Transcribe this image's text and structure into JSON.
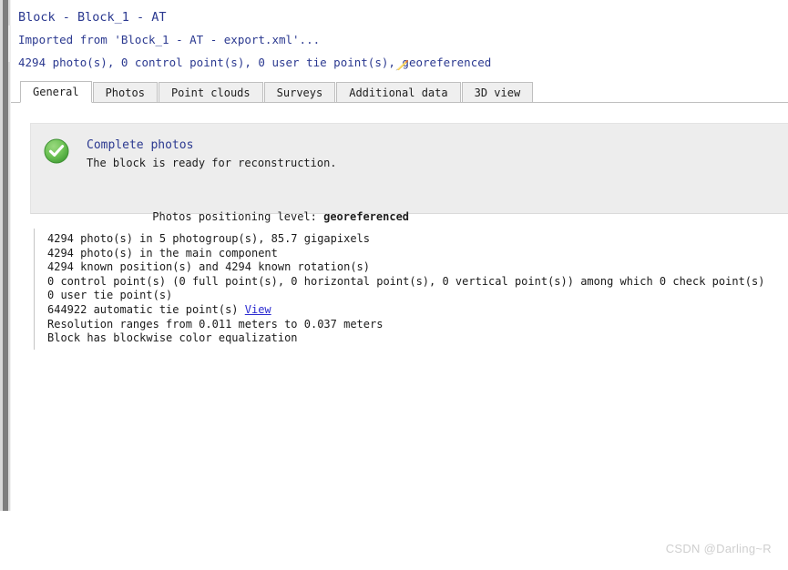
{
  "window": {
    "block_title": "Block - Block_1 - AT",
    "imported_line": "Imported from 'Block_1 - AT - export.xml'...",
    "summary_line": "4294 photo(s), 0 control point(s), 0 user tie point(s), georeferenced",
    "edit_icon": "pencil-icon",
    "title_color": "#2b3990"
  },
  "tabs": [
    {
      "label": "General",
      "active": true
    },
    {
      "label": "Photos",
      "active": false
    },
    {
      "label": "Point clouds",
      "active": false
    },
    {
      "label": "Surveys",
      "active": false
    },
    {
      "label": "Additional data",
      "active": false
    },
    {
      "label": "3D view",
      "active": false
    }
  ],
  "status_panel": {
    "icon": "success-check-icon",
    "icon_color": "#57b84b",
    "title": "Complete photos",
    "subtitle": "The block is ready for reconstruction.",
    "positioning_label": "Photos positioning level: ",
    "positioning_value": "georeferenced"
  },
  "statistics": {
    "lines": [
      "4294 photo(s) in 5 photogroup(s), 85.7 gigapixels",
      "4294 photo(s) in the main component",
      "4294 known position(s) and 4294 known rotation(s)",
      "0 control point(s) (0 full point(s), 0 horizontal point(s), 0 vertical point(s)) among which 0 check point(s)",
      "0 user tie point(s)"
    ],
    "tie_points_prefix": "644922 automatic tie point(s) ",
    "tie_points_link": "View",
    "lines_after": [
      "Resolution ranges from 0.011 meters to 0.037 meters",
      "Block has blockwise color equalization"
    ]
  },
  "watermark": {
    "text": "CSDN @Darling~R"
  }
}
